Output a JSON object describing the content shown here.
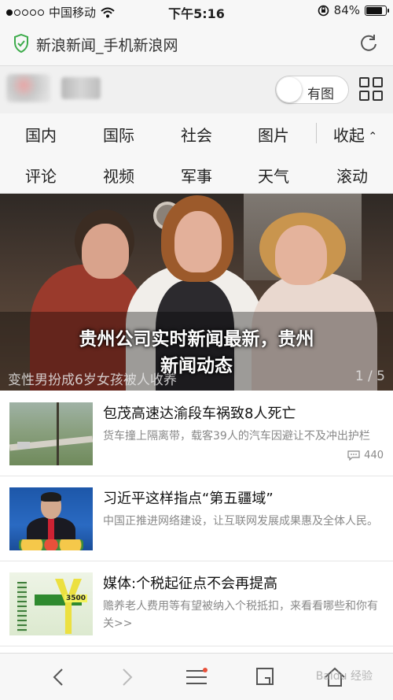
{
  "status_bar": {
    "carrier": "中国移动",
    "time": "下午5:16",
    "battery": "84%",
    "battery_level": 0.84
  },
  "address_bar": {
    "title": "新浪新闻_手机新浪网"
  },
  "site_header": {
    "toggle_label": "有图"
  },
  "categories": {
    "row1": [
      "国内",
      "国际",
      "社会",
      "图片",
      "收起"
    ],
    "row2": [
      "评论",
      "视频",
      "军事",
      "天气",
      "滚动"
    ]
  },
  "hero": {
    "title_line1": "贵州公司实时新闻最新，贵州",
    "title_line2": "新闻动态",
    "caption": "变性男扮成6岁女孩被人收养",
    "page_indicator": "1 / 5"
  },
  "news": [
    {
      "title": "包茂高速达渝段车祸致8人死亡",
      "summary": "货车撞上隔离带，载客39人的汽车因避让不及冲出护栏",
      "comments": "440"
    },
    {
      "title": "习近平这样指点“第五疆域”",
      "summary": "中国正推进网络建设，让互联网发展成果惠及全体人民。",
      "comments": ""
    },
    {
      "title": "媒体:个税起征点不会再提高",
      "summary": "赡养老人费用等有望被纳入个税抵扣，来看看哪些和你有关>>",
      "comments": ""
    }
  ],
  "thumb_labels": {
    "tax_amount": "3500"
  },
  "toolbar": {
    "watermark": "Baidu 经验"
  }
}
